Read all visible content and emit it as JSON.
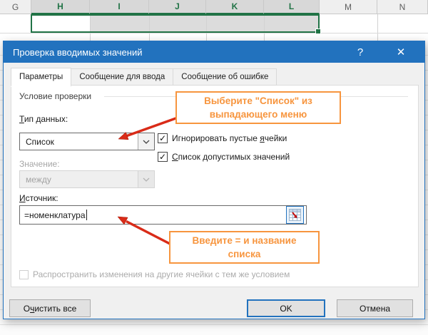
{
  "sheet": {
    "columns": [
      {
        "label": "G",
        "selected": false
      },
      {
        "label": "H",
        "selected": true
      },
      {
        "label": "I",
        "selected": true
      },
      {
        "label": "J",
        "selected": true
      },
      {
        "label": "K",
        "selected": true
      },
      {
        "label": "L",
        "selected": true
      },
      {
        "label": "M",
        "selected": false
      },
      {
        "label": "N",
        "selected": false
      }
    ]
  },
  "dialog": {
    "title": "Проверка вводимых значений",
    "help_icon": "?",
    "close_icon": "✕",
    "tabs": [
      {
        "label": "Параметры",
        "active": true
      },
      {
        "label": "Сообщение для ввода",
        "active": false
      },
      {
        "label": "Сообщение об ошибке",
        "active": false
      }
    ],
    "group_label": "Условие проверки",
    "data_type": {
      "label_key": "Т",
      "label_rest": "ип данных:",
      "value": "Список"
    },
    "checkboxes": [
      {
        "pre": "Игнорировать пустые ",
        "key": "я",
        "rest": "чейки",
        "checked": true
      },
      {
        "pre": "",
        "key": "С",
        "rest": "писок допустимых значений",
        "checked": true
      }
    ],
    "value_row": {
      "label": "Значение:",
      "value": "между",
      "disabled": true
    },
    "source": {
      "label_key": "И",
      "label_rest": "сточник:",
      "value": "=номенклатура"
    },
    "apply_checkbox": {
      "label": "Распространить изменения на другие ячейки с тем же условием",
      "checked": false,
      "disabled": true
    },
    "buttons": {
      "clear": {
        "pre": "О",
        "key": "ч",
        "rest": "истить все"
      },
      "ok": "OK",
      "cancel": "Отмена"
    }
  },
  "annotations": {
    "callout_dropdown": {
      "line1": "Выберите \"Список\" из",
      "line2": "выпадающего меню"
    },
    "callout_source": {
      "line1": "Введите = и название",
      "line2": "списка"
    }
  },
  "icons": {
    "checkmark": "✓"
  },
  "colors": {
    "title_bar_blue": "#2272BE",
    "excel_green": "#217346",
    "callout_orange": "#F7953E",
    "arrow_red": "#D92B18"
  }
}
